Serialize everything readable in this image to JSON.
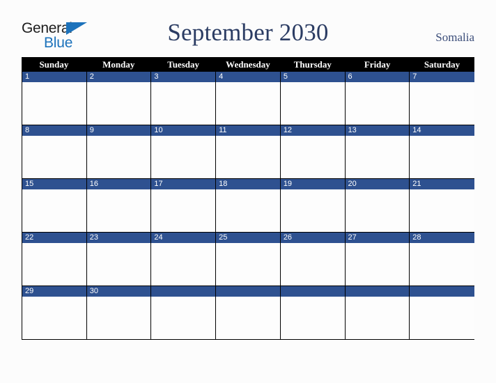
{
  "brand": {
    "name_part1": "General",
    "name_part2": "Blue",
    "triangle_icon": "triangle-icon",
    "color_dark": "#1c1c1c",
    "color_blue": "#1c72bb"
  },
  "header": {
    "title": "September 2030",
    "region": "Somalia",
    "title_color": "#2b3c63",
    "region_color": "#3c4e7a"
  },
  "calendar": {
    "month": "September",
    "year": "2030",
    "weekday_headers": [
      "Sunday",
      "Monday",
      "Tuesday",
      "Wednesday",
      "Thursday",
      "Friday",
      "Saturday"
    ],
    "header_bg": "#000000",
    "header_text": "#ffffff",
    "date_band_bg": "#2e5190",
    "date_text": "#ffffff",
    "cell_bg": "#fdfdfd",
    "border_color": "#000000",
    "weeks": [
      {
        "days": [
          {
            "number": "1",
            "empty": false
          },
          {
            "number": "2",
            "empty": false
          },
          {
            "number": "3",
            "empty": false
          },
          {
            "number": "4",
            "empty": false
          },
          {
            "number": "5",
            "empty": false
          },
          {
            "number": "6",
            "empty": false
          },
          {
            "number": "7",
            "empty": false
          }
        ]
      },
      {
        "days": [
          {
            "number": "8",
            "empty": false
          },
          {
            "number": "9",
            "empty": false
          },
          {
            "number": "10",
            "empty": false
          },
          {
            "number": "11",
            "empty": false
          },
          {
            "number": "12",
            "empty": false
          },
          {
            "number": "13",
            "empty": false
          },
          {
            "number": "14",
            "empty": false
          }
        ]
      },
      {
        "days": [
          {
            "number": "15",
            "empty": false
          },
          {
            "number": "16",
            "empty": false
          },
          {
            "number": "17",
            "empty": false
          },
          {
            "number": "18",
            "empty": false
          },
          {
            "number": "19",
            "empty": false
          },
          {
            "number": "20",
            "empty": false
          },
          {
            "number": "21",
            "empty": false
          }
        ]
      },
      {
        "days": [
          {
            "number": "22",
            "empty": false
          },
          {
            "number": "23",
            "empty": false
          },
          {
            "number": "24",
            "empty": false
          },
          {
            "number": "25",
            "empty": false
          },
          {
            "number": "26",
            "empty": false
          },
          {
            "number": "27",
            "empty": false
          },
          {
            "number": "28",
            "empty": false
          }
        ]
      },
      {
        "days": [
          {
            "number": "29",
            "empty": false
          },
          {
            "number": "30",
            "empty": false
          },
          {
            "number": "",
            "empty": true
          },
          {
            "number": "",
            "empty": true
          },
          {
            "number": "",
            "empty": true
          },
          {
            "number": "",
            "empty": true
          },
          {
            "number": "",
            "empty": true
          }
        ]
      }
    ]
  }
}
